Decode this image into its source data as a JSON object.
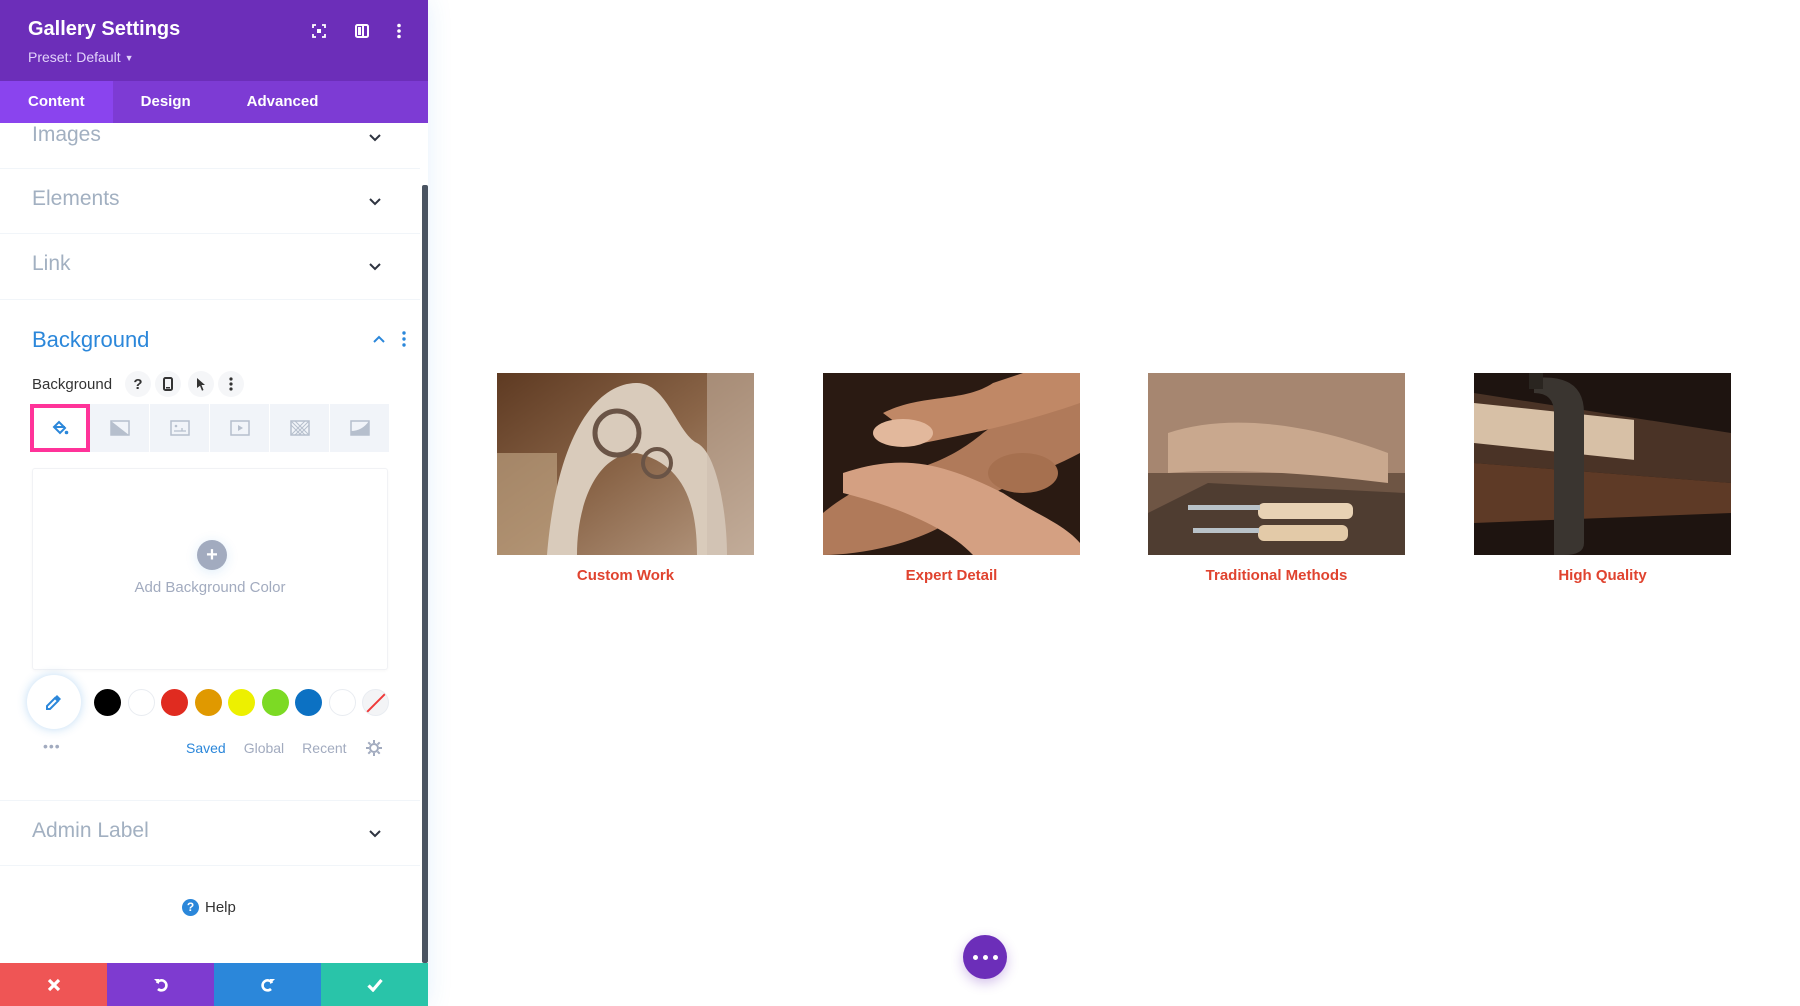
{
  "panel": {
    "title": "Gallery Settings",
    "preset": "Preset: Default",
    "header_icons": [
      "fullscreen-icon",
      "split-view-icon",
      "more-vertical-icon"
    ],
    "tabs": [
      {
        "label": "Content",
        "active": true
      },
      {
        "label": "Design",
        "active": false
      },
      {
        "label": "Advanced",
        "active": false
      }
    ],
    "sections": {
      "images": "Images",
      "elements": "Elements",
      "link": "Link",
      "background": "Background",
      "admin_label": "Admin Label"
    },
    "background_field": {
      "label": "Background",
      "icons": [
        "help-icon",
        "responsive-icon",
        "hover-cursor-icon",
        "more-vertical-icon"
      ],
      "type_tabs": [
        "color",
        "gradient",
        "image",
        "video",
        "pattern",
        "mask"
      ],
      "active_type": "color",
      "add_color_label": "Add Background Color",
      "eyedropper_more": "•••",
      "swatches": [
        "#000000",
        "#ffffff",
        "#e02b20",
        "#e09900",
        "#edf000",
        "#7cda24",
        "#0c71c3",
        "#ffffff",
        "none"
      ],
      "palette_tabs": [
        {
          "label": "Saved",
          "active": true
        },
        {
          "label": "Global",
          "active": false
        },
        {
          "label": "Recent",
          "active": false
        }
      ]
    },
    "help_label": "Help",
    "footer_buttons": [
      {
        "name": "discard",
        "icon": "close-icon",
        "color": "#ef5555"
      },
      {
        "name": "undo",
        "icon": "undo-icon",
        "color": "#7e3bd0"
      },
      {
        "name": "redo",
        "icon": "redo-icon",
        "color": "#2b87da"
      },
      {
        "name": "save",
        "icon": "check-icon",
        "color": "#29c4a9"
      }
    ]
  },
  "colors": {
    "header": "#6c2eb9",
    "tabs": "#7d3bd4",
    "tab_active": "#8a44ee",
    "accent_blue": "#2b87da",
    "active_type_border": "#ff3399",
    "caption": "#e0432f"
  },
  "gallery": {
    "items": [
      {
        "caption": "Custom Work",
        "image": "carved-wooden-chair-back"
      },
      {
        "caption": "Expert Detail",
        "image": "ornate-wood-carving-closeup"
      },
      {
        "caption": "Traditional Methods",
        "image": "carving-chisels-on-workbench"
      },
      {
        "caption": "High Quality",
        "image": "clamp-on-wood-board"
      }
    ]
  },
  "fab": {
    "icon": "more-horizontal-icon"
  }
}
